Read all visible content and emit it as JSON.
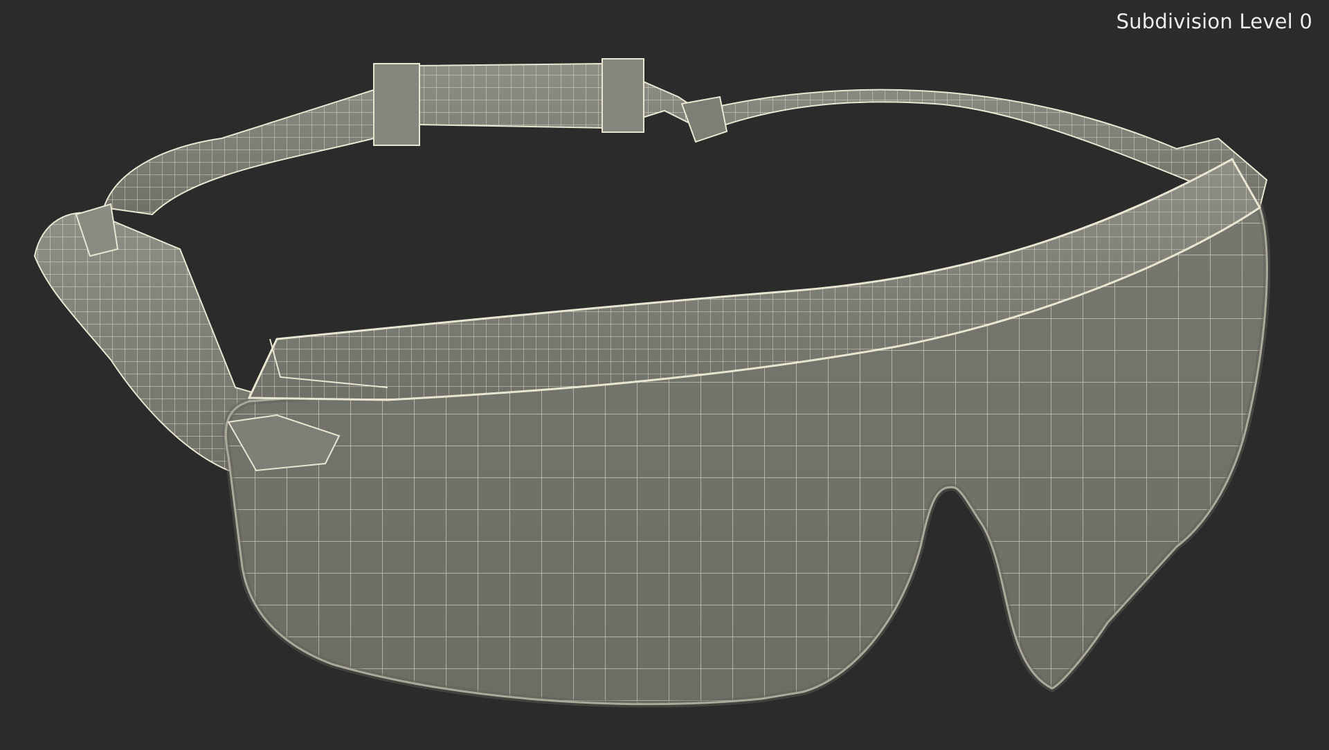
{
  "overlay": {
    "subdivision_label": "Subdivision Level 0"
  },
  "scene": {
    "object_icon": "safety-goggles-wireframe",
    "background_color": "#2b2b2b",
    "surface_color": "#7a7a70",
    "wire_color": "#e8e6d2"
  }
}
